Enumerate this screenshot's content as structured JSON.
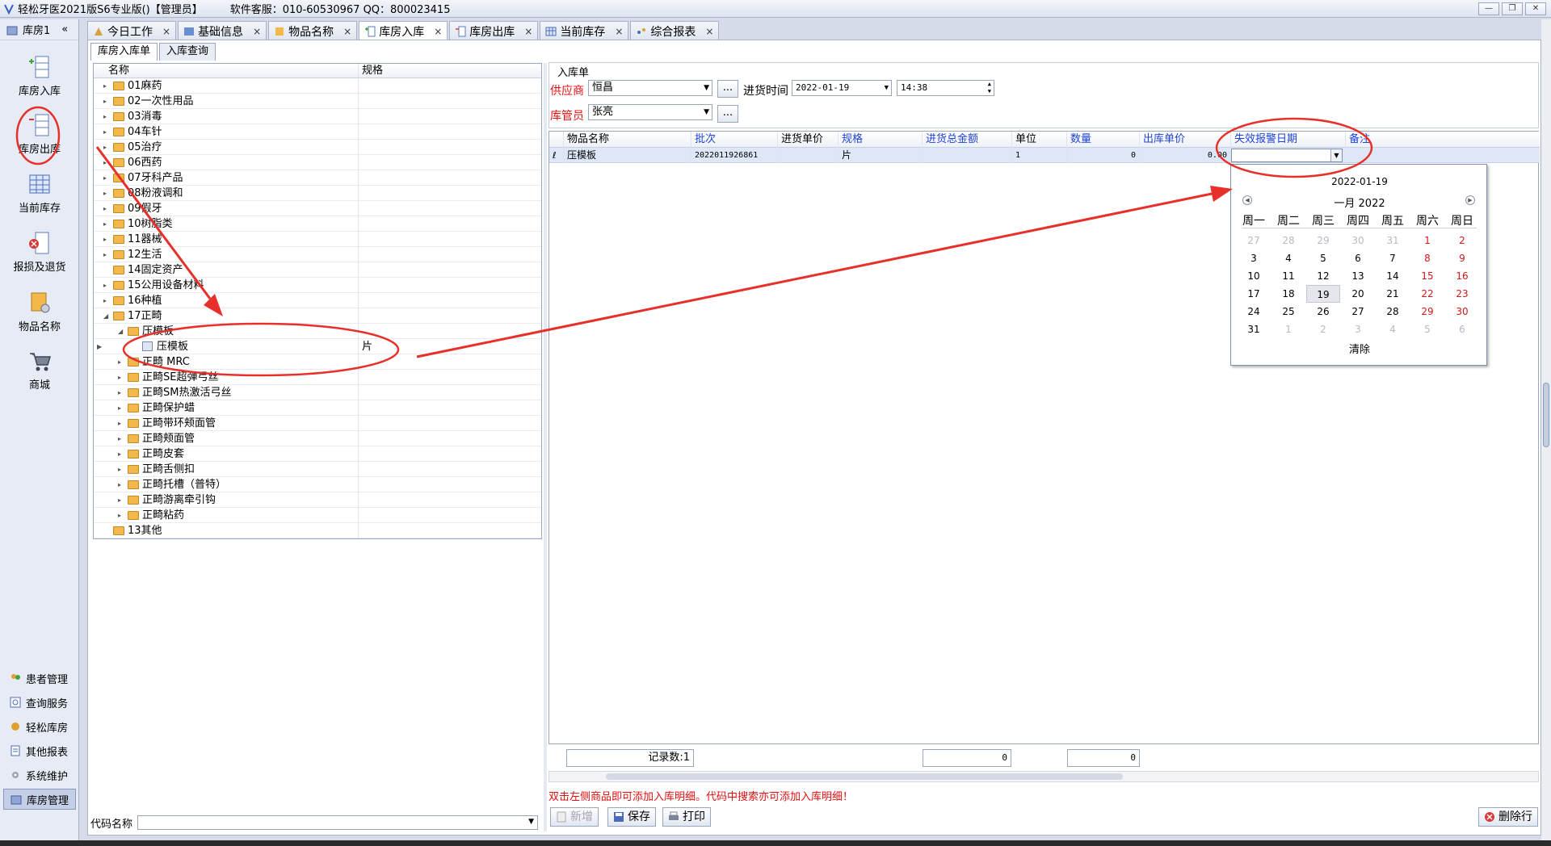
{
  "window": {
    "title": "轻松牙医2021版S6专业版()【管理员】",
    "service": "软件客服：010-60530967 QQ：800023415"
  },
  "leftbar": {
    "header": "库房1",
    "collapse": "«",
    "big_items": [
      {
        "label": "库房入库",
        "icon": "warehouse-in-icon"
      },
      {
        "label": "库房出库",
        "icon": "warehouse-out-icon"
      },
      {
        "label": "当前库存",
        "icon": "table-grid-icon"
      },
      {
        "label": "报损及退货",
        "icon": "return-icon"
      },
      {
        "label": "物品名称",
        "icon": "item-gear-icon"
      },
      {
        "label": "商城",
        "icon": "cart-icon"
      }
    ],
    "small_items": [
      {
        "label": "患者管理",
        "icon": "patients-icon"
      },
      {
        "label": "查询服务",
        "icon": "query-icon"
      },
      {
        "label": "轻松库房",
        "icon": "store-icon"
      },
      {
        "label": "其他报表",
        "icon": "report-icon"
      },
      {
        "label": "系统维护",
        "icon": "wrench-icon"
      },
      {
        "label": "库房管理",
        "icon": "warehouse-icon"
      }
    ]
  },
  "tabs": [
    {
      "label": "今日工作",
      "icon": "calendar-icon",
      "close": "×"
    },
    {
      "label": "基础信息",
      "icon": "info-icon",
      "close": "×"
    },
    {
      "label": "物品名称",
      "icon": "item-icon",
      "close": "×"
    },
    {
      "label": "库房入库",
      "icon": "warehouse-in-icon",
      "close": "×"
    },
    {
      "label": "库房出库",
      "icon": "warehouse-out-icon",
      "close": "×"
    },
    {
      "label": "当前库存",
      "icon": "table-grid-icon",
      "close": "×"
    },
    {
      "label": "综合报表",
      "icon": "chart-icon",
      "close": "×"
    }
  ],
  "subtabs": [
    "库房入库单",
    "入库查询"
  ],
  "tree": {
    "headers": [
      "名称",
      "规格"
    ],
    "rows": [
      {
        "label": "01麻药",
        "spec": ""
      },
      {
        "label": "02一次性用品",
        "spec": ""
      },
      {
        "label": "03消毒",
        "spec": ""
      },
      {
        "label": "04车针",
        "spec": ""
      },
      {
        "label": "05治疗",
        "spec": ""
      },
      {
        "label": "06西药",
        "spec": ""
      },
      {
        "label": "07牙科产品",
        "spec": ""
      },
      {
        "label": "08粉液调和",
        "spec": ""
      },
      {
        "label": "09假牙",
        "spec": ""
      },
      {
        "label": "10树脂类",
        "spec": ""
      },
      {
        "label": "11器械",
        "spec": ""
      },
      {
        "label": "12生活",
        "spec": ""
      },
      {
        "label": "14固定资产",
        "spec": ""
      },
      {
        "label": "15公用设备材料",
        "spec": ""
      },
      {
        "label": "16种植",
        "spec": ""
      },
      {
        "label": "17正畸",
        "spec": ""
      },
      {
        "label": "压模板",
        "spec": ""
      },
      {
        "label": "压模板",
        "spec": "片"
      },
      {
        "label": "正畸 MRC",
        "spec": ""
      },
      {
        "label": "正畸SE超弹弓丝",
        "spec": ""
      },
      {
        "label": "正畸SM热激活弓丝",
        "spec": ""
      },
      {
        "label": "正畸保护蜡",
        "spec": ""
      },
      {
        "label": "正畸带环颊面管",
        "spec": ""
      },
      {
        "label": "正畸颊面管",
        "spec": ""
      },
      {
        "label": "正畸皮套",
        "spec": ""
      },
      {
        "label": "正畸舌侧扣",
        "spec": ""
      },
      {
        "label": "正畸托槽（普特）",
        "spec": ""
      },
      {
        "label": "正畸游离牵引钩",
        "spec": ""
      },
      {
        "label": "正畸粘药",
        "spec": ""
      },
      {
        "label": "13其他",
        "spec": ""
      }
    ]
  },
  "code_search": {
    "label": "代码名称",
    "value": ""
  },
  "form": {
    "section_title": "入库单",
    "supplier_label": "供应商",
    "supplier_value": "恒昌",
    "date_label": "进货时间",
    "date_value": "2022-01-19",
    "time_value": "14:38",
    "keeper_label": "库管员",
    "keeper_value": "张亮",
    "dots": "..."
  },
  "grid": {
    "headers": [
      "物品名称",
      "批次",
      "进货单价",
      "规格",
      "进货总金额",
      "单位",
      "数量",
      "出库单价",
      "失效报警日期",
      "备注"
    ],
    "row": {
      "marker": "ℓ",
      "name": "压模板",
      "batch": "2022011926861",
      "price": "",
      "spec": "片",
      "total": "",
      "unit": "1",
      "qty": "0",
      "out_price": "0.00",
      "expiry": "",
      "note": ""
    }
  },
  "calendar": {
    "today_label": "2022-01-19",
    "month_label": "一月 2022",
    "weekdays": [
      "周一",
      "周二",
      "周三",
      "周四",
      "周五",
      "周六",
      "周日"
    ],
    "weeks": [
      [
        "27",
        "28",
        "29",
        "30",
        "31",
        "1",
        "2"
      ],
      [
        "3",
        "4",
        "5",
        "6",
        "7",
        "8",
        "9"
      ],
      [
        "10",
        "11",
        "12",
        "13",
        "14",
        "15",
        "16"
      ],
      [
        "17",
        "18",
        "19",
        "20",
        "21",
        "22",
        "23"
      ],
      [
        "24",
        "25",
        "26",
        "27",
        "28",
        "29",
        "30"
      ],
      [
        "31",
        "1",
        "2",
        "3",
        "4",
        "5",
        "6"
      ]
    ],
    "selected_day": "19",
    "clear_label": "清除"
  },
  "footer": {
    "record_label": "记录数:1",
    "sum1": "0",
    "sum2": "0"
  },
  "hint": "双击左侧商品即可添加入库明细。代码中搜索亦可添加入库明细！",
  "toolbar": {
    "new_label": "新增",
    "save_label": "保存",
    "print_label": "打印",
    "delete_row_label": "删除行"
  },
  "colors": {
    "annotation": "#e8302a",
    "required_label": "#e01010",
    "header_blue": "#1c43d8",
    "weekend": "#d01818"
  }
}
